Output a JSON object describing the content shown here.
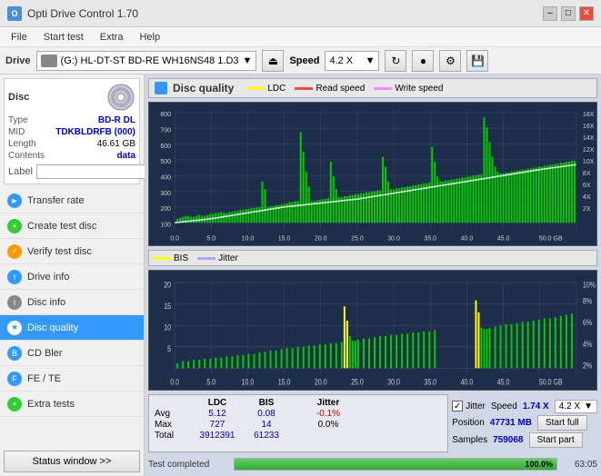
{
  "window": {
    "title": "Opti Drive Control 1.70",
    "minimize_btn": "–",
    "maximize_btn": "□",
    "close_btn": "✕"
  },
  "menu": {
    "items": [
      "File",
      "Start test",
      "Extra",
      "Help"
    ]
  },
  "drive_bar": {
    "label": "Drive",
    "drive_name": "(G:)  HL-DT-ST BD-RE  WH16NS48 1.D3",
    "speed_label": "Speed",
    "speed_value": "4.2 X"
  },
  "disc": {
    "title": "Disc",
    "type_label": "Type",
    "type_value": "BD-R DL",
    "mid_label": "MID",
    "mid_value": "TDKBLDRFB (000)",
    "length_label": "Length",
    "length_value": "46.61 GB",
    "contents_label": "Contents",
    "contents_value": "data",
    "label_label": "Label"
  },
  "nav": {
    "items": [
      {
        "id": "transfer-rate",
        "label": "Transfer rate",
        "active": false
      },
      {
        "id": "create-test-disc",
        "label": "Create test disc",
        "active": false
      },
      {
        "id": "verify-test-disc",
        "label": "Verify test disc",
        "active": false
      },
      {
        "id": "drive-info",
        "label": "Drive info",
        "active": false
      },
      {
        "id": "disc-info",
        "label": "Disc info",
        "active": false
      },
      {
        "id": "disc-quality",
        "label": "Disc quality",
        "active": true
      },
      {
        "id": "cd-bler",
        "label": "CD Bler",
        "active": false
      },
      {
        "id": "fe-te",
        "label": "FE / TE",
        "active": false
      },
      {
        "id": "extra-tests",
        "label": "Extra tests",
        "active": false
      }
    ]
  },
  "status_btn": "Status window >>",
  "chart": {
    "title": "Disc quality",
    "legend": {
      "ldc_label": "LDC",
      "read_speed_label": "Read speed",
      "write_speed_label": "Write speed"
    },
    "top_y_labels": [
      "800",
      "700",
      "600",
      "500",
      "400",
      "300",
      "200",
      "100"
    ],
    "top_y_right": [
      "18X",
      "16X",
      "14X",
      "12X",
      "10X",
      "8X",
      "6X",
      "4X",
      "2X"
    ],
    "top_x_labels": [
      "0.0",
      "5.0",
      "10.0",
      "15.0",
      "20.0",
      "25.0",
      "30.0",
      "35.0",
      "40.0",
      "45.0",
      "50.0 GB"
    ],
    "bis_y_labels": [
      "20",
      "15",
      "10",
      "5"
    ],
    "bis_y_right": [
      "10%",
      "8%",
      "6%",
      "4%",
      "2%"
    ],
    "bis_x_labels": [
      "0.0",
      "5.0",
      "10.0",
      "15.0",
      "20.0",
      "25.0",
      "30.0",
      "35.0",
      "40.0",
      "45.0",
      "50.0 GB"
    ],
    "bis_legend": {
      "bis_label": "BIS",
      "jitter_label": "Jitter"
    }
  },
  "stats": {
    "col_headers": [
      "",
      "LDC",
      "BIS",
      "",
      "Jitter"
    ],
    "avg_label": "Avg",
    "avg_ldc": "5.12",
    "avg_bis": "0.08",
    "avg_jitter": "-0.1%",
    "max_label": "Max",
    "max_ldc": "727",
    "max_bis": "14",
    "max_jitter": "0.0%",
    "total_label": "Total",
    "total_ldc": "3912391",
    "total_bis": "61233",
    "jitter_checked": true,
    "speed_label": "Speed",
    "speed_value": "1.74 X",
    "speed_dropdown": "4.2 X",
    "position_label": "Position",
    "position_value": "47731 MB",
    "samples_label": "Samples",
    "samples_value": "759068",
    "start_full_btn": "Start full",
    "start_part_btn": "Start part"
  },
  "bottom": {
    "status_text": "Test completed",
    "progress_pct": "100.0%",
    "time_text": "63:05",
    "progress_width": 100
  }
}
